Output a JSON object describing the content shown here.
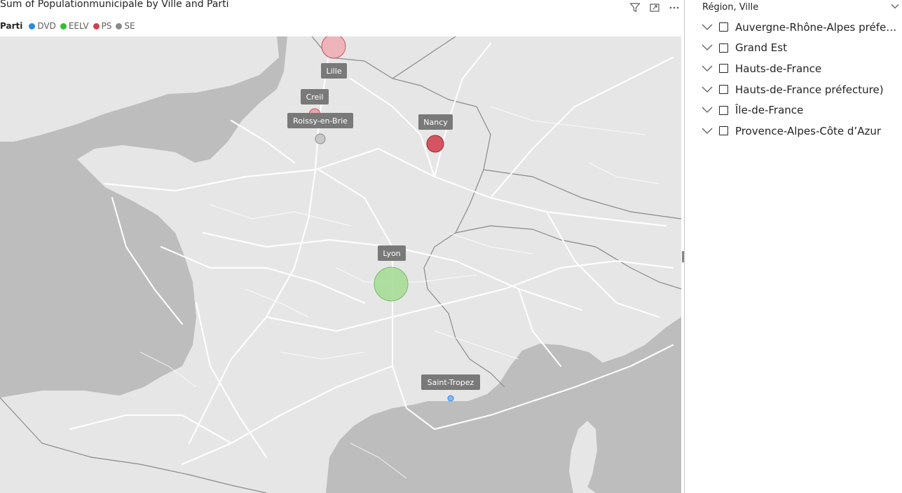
{
  "visual": {
    "title": "Sum of Populationmunicipale by Ville and Parti",
    "header_icons": [
      "filter-icon",
      "focus-mode-icon",
      "more-options-icon"
    ]
  },
  "legend": {
    "title": "Parti",
    "items": [
      {
        "label": "DVD",
        "color": "#2b8ae2"
      },
      {
        "label": "EELV",
        "color": "#2ec02e"
      },
      {
        "label": "PS",
        "color": "#d04052"
      },
      {
        "label": "SE",
        "color": "#8a8a8a"
      }
    ]
  },
  "map": {
    "cities": [
      {
        "name": "Lille",
        "parti": "PS",
        "color": "#e8a0a8"
      },
      {
        "name": "Creil",
        "parti": "PS",
        "color": "#e8a0a8"
      },
      {
        "name": "Roissy-en-Brie",
        "parti": "SE",
        "color": "#c4c4c4"
      },
      {
        "name": "Nancy",
        "parti": "PS",
        "color": "#d04052"
      },
      {
        "name": "Lyon",
        "parti": "EELV",
        "color": "#a8dc98"
      },
      {
        "name": "Saint-Tropez",
        "parti": "DVD",
        "color": "#8ab8ec"
      }
    ]
  },
  "slicer": {
    "header": "Région, Ville",
    "items": [
      {
        "label": "Auvergne-Rhône-Alpes préfecture)"
      },
      {
        "label": "Grand Est"
      },
      {
        "label": "Hauts-de-France"
      },
      {
        "label": "Hauts-de-France préfecture)"
      },
      {
        "label": "Île-de-France"
      },
      {
        "label": "Provence-Alpes-Côte d’Azur"
      }
    ]
  }
}
